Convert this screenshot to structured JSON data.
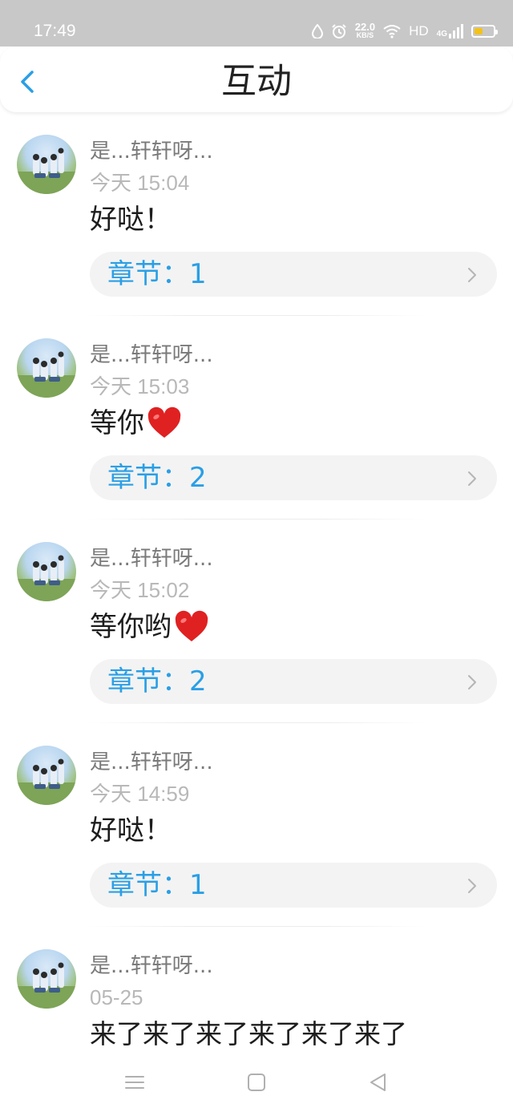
{
  "status_bar": {
    "time": "17:49",
    "speed_value": "22.0",
    "speed_unit": "KB/S",
    "hd": "HD",
    "network": "4G",
    "battery_color": "#f3c21a"
  },
  "header": {
    "title": "互动"
  },
  "colors": {
    "accent": "#2a9fe6",
    "heart": "#e02121"
  },
  "comments": [
    {
      "name": "是...轩轩呀...",
      "time": "今天 15:04",
      "content": "好哒！",
      "heart": false,
      "chapter": "章节：1"
    },
    {
      "name": "是...轩轩呀...",
      "time": "今天 15:03",
      "content": "等你",
      "heart": true,
      "chapter": "章节：2"
    },
    {
      "name": "是...轩轩呀...",
      "time": "今天 15:02",
      "content": "等你哟",
      "heart": true,
      "chapter": "章节：2"
    },
    {
      "name": "是...轩轩呀...",
      "time": "今天 14:59",
      "content": "好哒！",
      "heart": false,
      "chapter": "章节：1"
    },
    {
      "name": "是...轩轩呀...",
      "time": "05-25",
      "content": "来了来了来了来了来了来了",
      "heart": false,
      "chapter": ""
    }
  ],
  "nav_bar": {
    "icons": [
      "menu-icon",
      "home-icon",
      "back-icon"
    ]
  }
}
